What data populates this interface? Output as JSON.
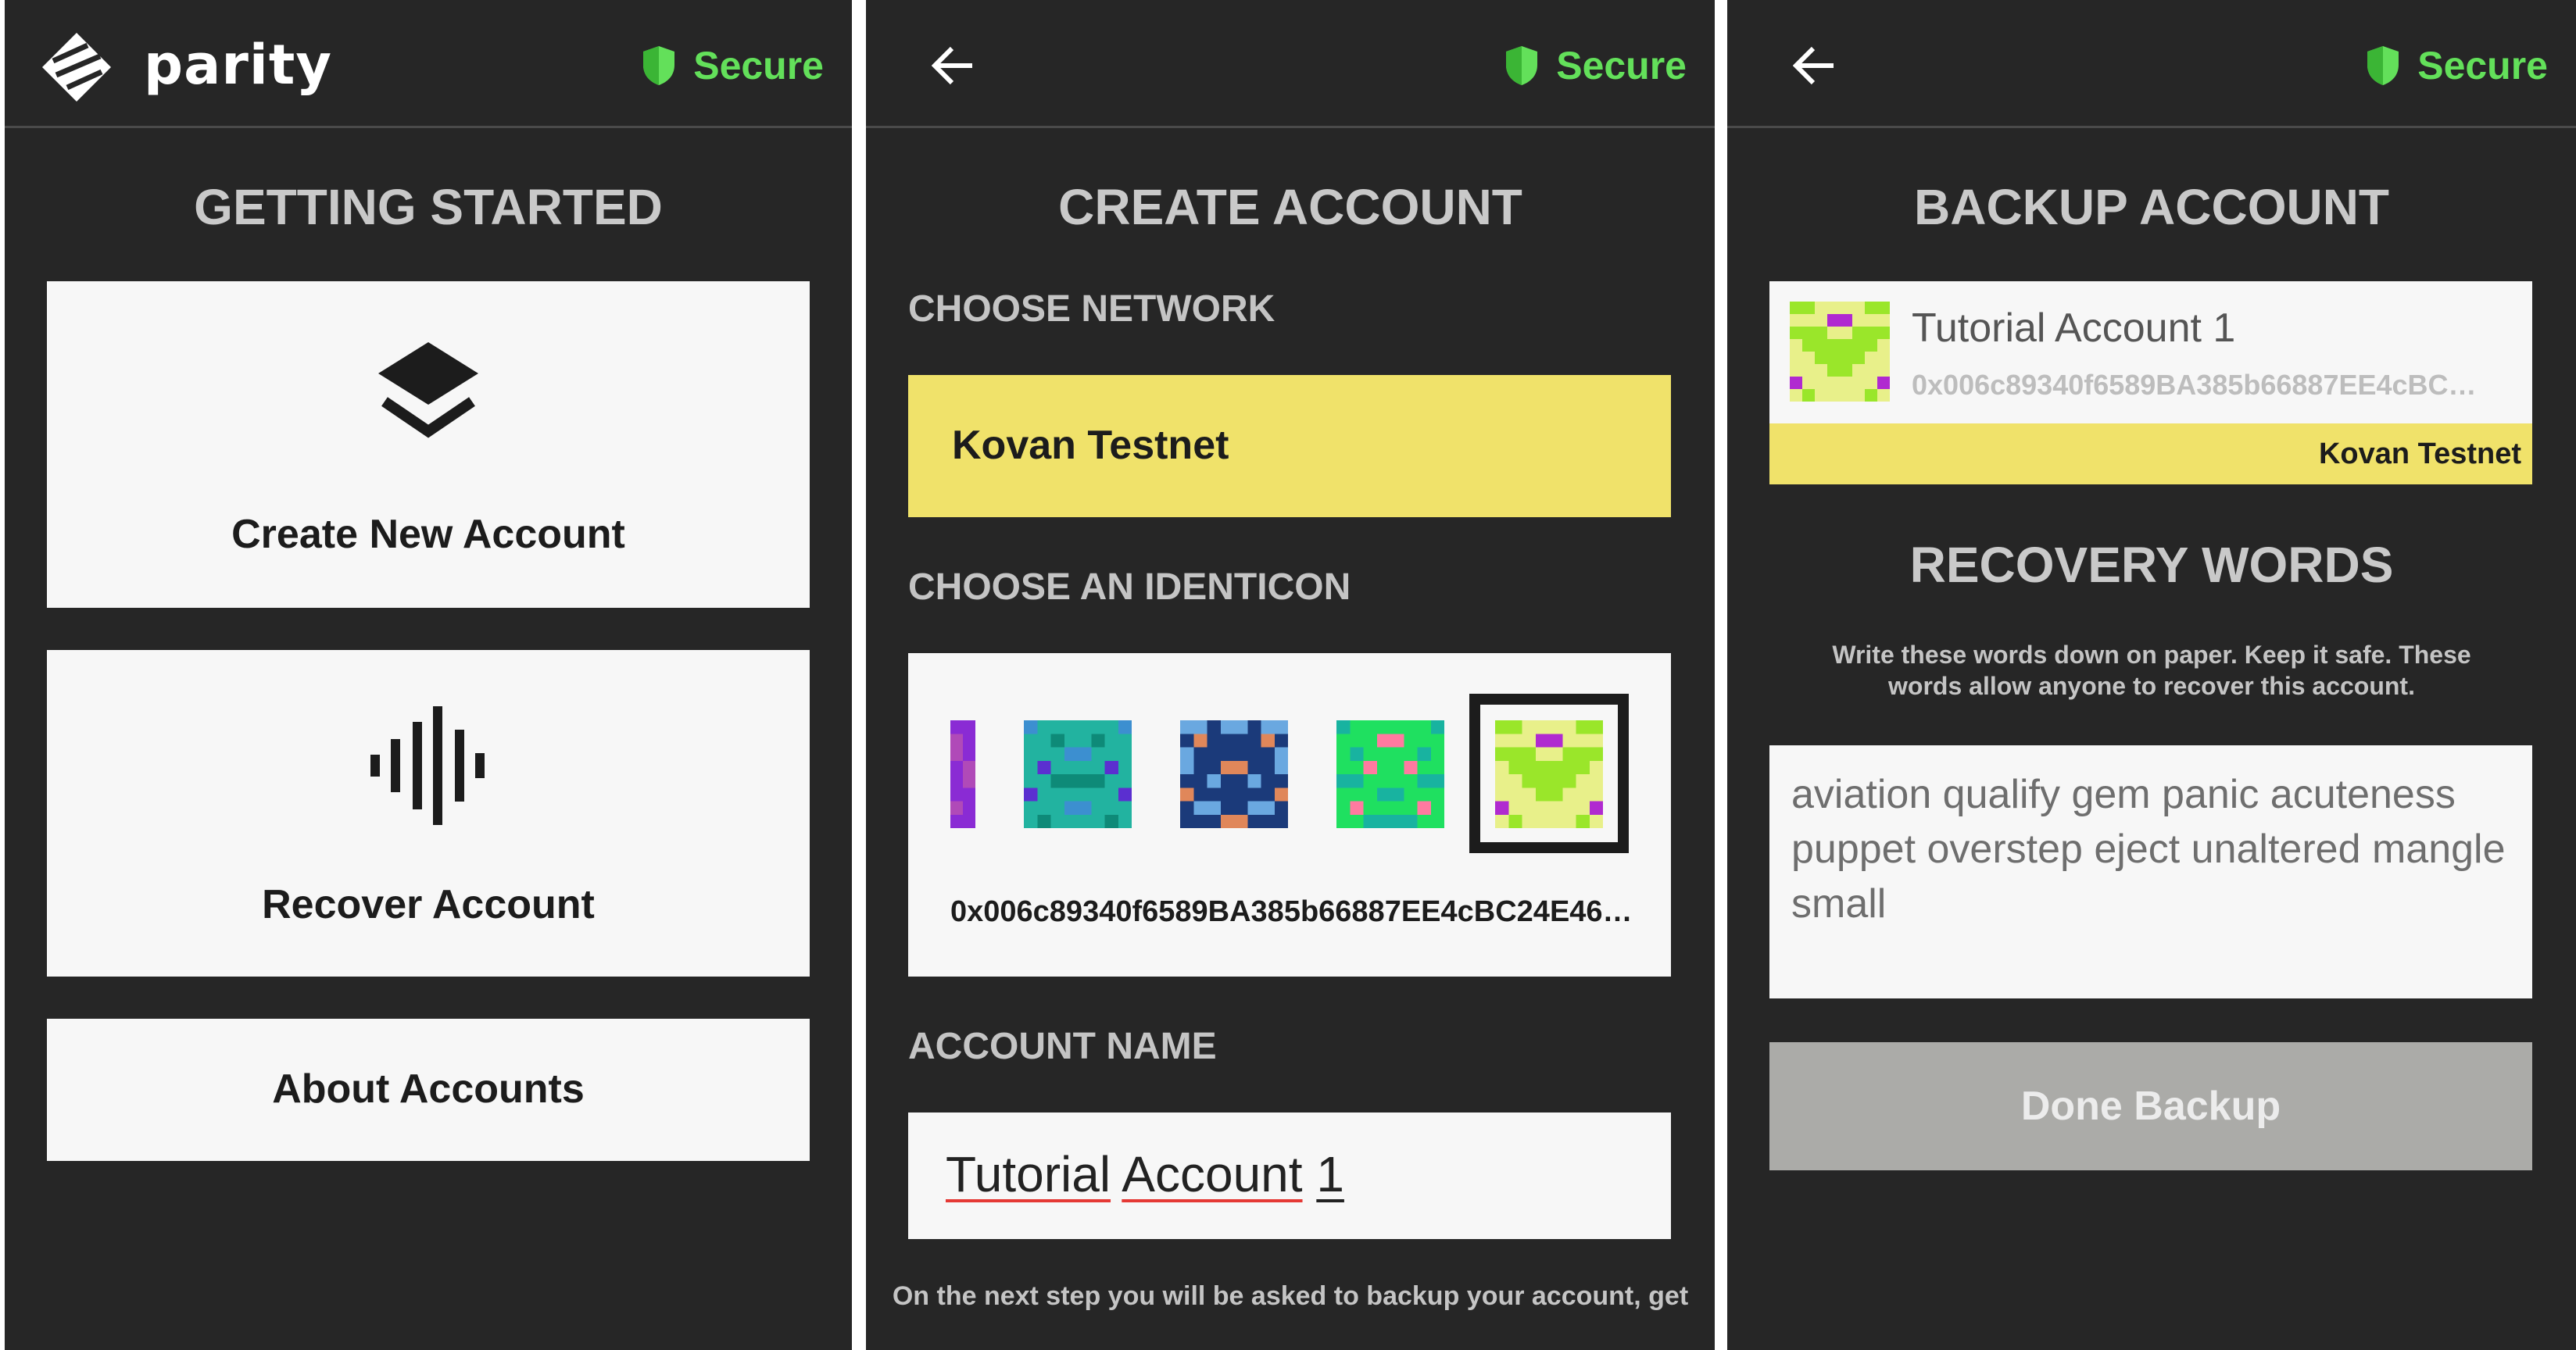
{
  "common": {
    "secure_label": "Secure",
    "accent_green": "#63e05a",
    "network_yellow": "#f0e26a"
  },
  "screen1": {
    "logo_text": "parity",
    "title": "GETTING STARTED",
    "create_label": "Create New Account",
    "recover_label": "Recover Account",
    "about_label": "About Accounts",
    "create_icon": "layers-icon",
    "recover_icon": "sound-wave-icon"
  },
  "screen2": {
    "title": "CREATE ACCOUNT",
    "network_heading": "CHOOSE NETWORK",
    "network_value": "Kovan Testnet",
    "identicon_heading": "CHOOSE AN IDENTICON",
    "address": "0x006c89340f6589BA385b66887EE4cBC24E46…",
    "name_heading": "ACCOUNT NAME",
    "name_word1": "Tutorial",
    "name_word2": "Account",
    "name_word3": "1",
    "footer_note": "On the next step you will be asked to backup your account, get"
  },
  "screen3": {
    "title": "BACKUP ACCOUNT",
    "account_name": "Tutorial Account 1",
    "account_address": "0x006c89340f6589BA385b66887EE4cBC…",
    "network": "Kovan Testnet",
    "recovery_title": "RECOVERY WORDS",
    "instructions": "Write these words down on paper. Keep it safe. These words allow anyone to recover this account.",
    "words": "aviation qualify gem panic acuteness puppet overstep eject unaltered mangle small",
    "done_label": "Done Backup"
  }
}
